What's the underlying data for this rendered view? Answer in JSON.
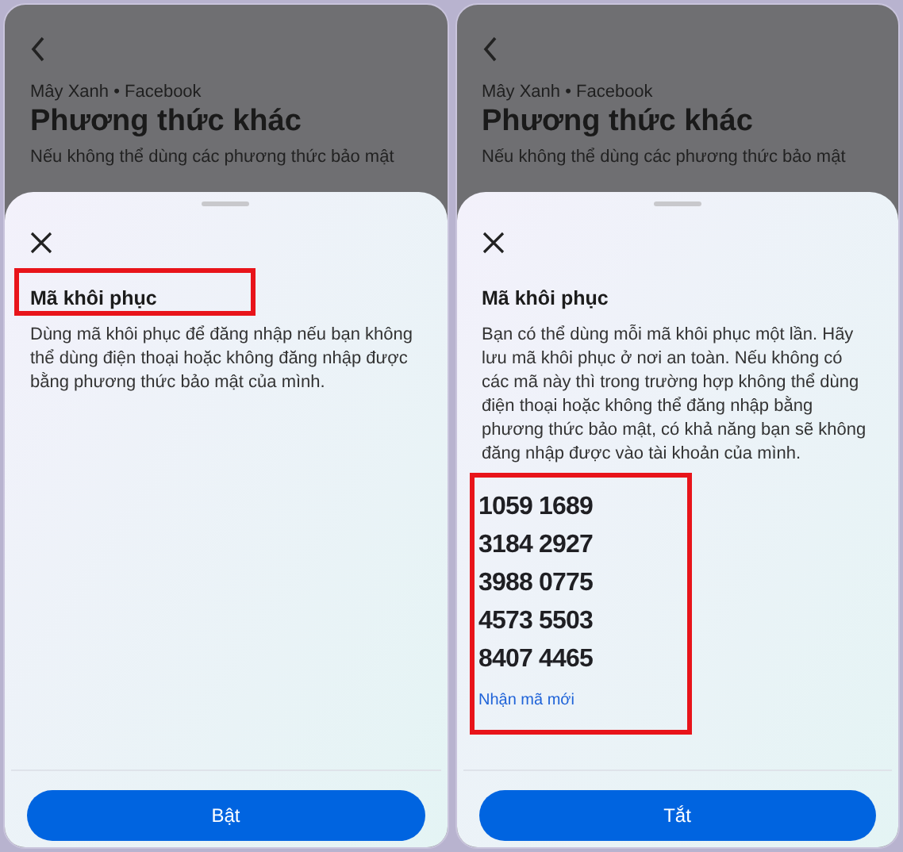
{
  "screens": [
    {
      "background": {
        "breadcrumb": "Mây Xanh • Facebook",
        "title": "Phương thức khác",
        "description": "Nếu không thể dùng các phương thức bảo mật"
      },
      "sheet": {
        "title": "Mã khôi phục",
        "title_highlighted": true,
        "description": "Dùng mã khôi phục để đăng nhập nếu bạn không thể dùng điện thoại hoặc không đăng nhập được bằng phương thức bảo mật của mình.",
        "button": "Bật"
      }
    },
    {
      "background": {
        "breadcrumb": "Mây Xanh • Facebook",
        "title": "Phương thức khác",
        "description": "Nếu không thể dùng các phương thức bảo mật"
      },
      "sheet": {
        "title": "Mã khôi phục",
        "title_highlighted": false,
        "codes_highlighted": true,
        "description": "Bạn có thể dùng mỗi mã khôi phục một lần. Hãy lưu mã khôi phục ở nơi an toàn. Nếu không có các mã này thì trong trường hợp không thể dùng điện thoại hoặc không thể đăng nhập bằng phương thức bảo mật, có khả năng bạn sẽ không đăng nhập được vào tài khoản của mình.",
        "codes": [
          "1059 1689",
          "3184 2927",
          "3988 0775",
          "4573 5503",
          "8407 4465"
        ],
        "link": "Nhận mã mới",
        "button": "Tắt"
      }
    }
  ]
}
